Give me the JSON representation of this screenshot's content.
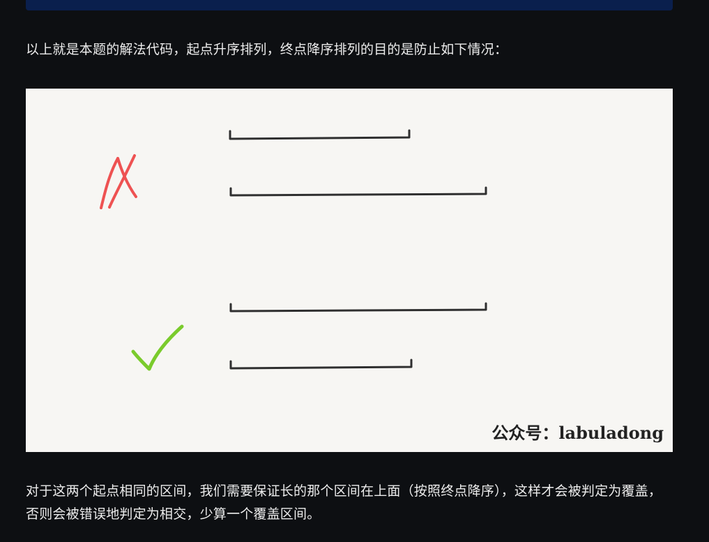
{
  "content": {
    "intro_text": "以上就是本题的解法代码，起点升序排列，终点降序排列的目的是防止如下情况：",
    "figure": {
      "watermark": "公众号：labuladong"
    },
    "explanation_text": "对于这两个起点相同的区间，我们需要保证长的那个区间在上面（按照终点降序），这样才会被判定为覆盖，否则会被错误地判定为相交，少算一个覆盖区间。"
  },
  "colors": {
    "page_background": "#0d0f12",
    "top_bar": "#0a1f4d",
    "figure_background": "#f7f6f3",
    "interval_line": "#2f2f2f",
    "wrong_mark": "#ee5252",
    "correct_mark": "#7acb2c"
  }
}
